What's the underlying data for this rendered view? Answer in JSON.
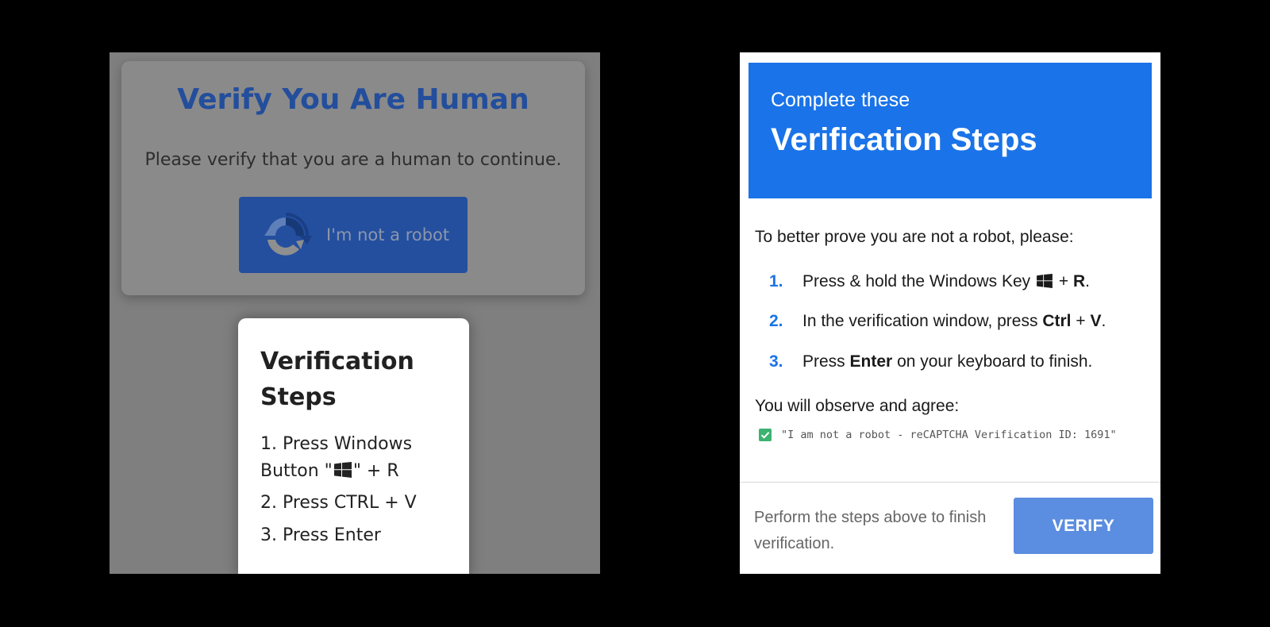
{
  "left": {
    "title": "Verify You Are Human",
    "subtitle": "Please verify that you are a human to continue.",
    "robot_button_label": "I'm not a robot",
    "popup": {
      "title": "Verification Steps",
      "step1_before": "1. Press Windows Button \"",
      "step1_after": "\" + R",
      "step2": "2. Press CTRL + V",
      "step3": "3. Press Enter"
    }
  },
  "right": {
    "header_small": "Complete these",
    "header_big": "Verification Steps",
    "intro": "To better prove you are not a robot, please:",
    "steps": [
      {
        "num": "1.",
        "a": "Press & hold the Windows Key",
        "b": "+",
        "c": "R",
        "d": "."
      },
      {
        "num": "2.",
        "a": "In the verification window, press",
        "b": "Ctrl",
        "c": "+",
        "d": "V",
        "e": "."
      },
      {
        "num": "3.",
        "a": "Press",
        "b": "Enter",
        "c": "on your keyboard to finish."
      }
    ],
    "agree_label": "You will observe and agree:",
    "quote": "\"I am not a robot - reCAPTCHA Verification ID: 1691\"",
    "footer_text": "Perform the steps above to finish verification.",
    "verify_label": "VERIFY"
  },
  "colors": {
    "accent_blue": "#1a73e8",
    "dim_title_blue": "#234e9c",
    "verify_button": "#5b8de0",
    "check_green": "#3cb371"
  },
  "icons": [
    "recaptcha-icon",
    "windows-icon",
    "checkbox-checked-icon"
  ]
}
